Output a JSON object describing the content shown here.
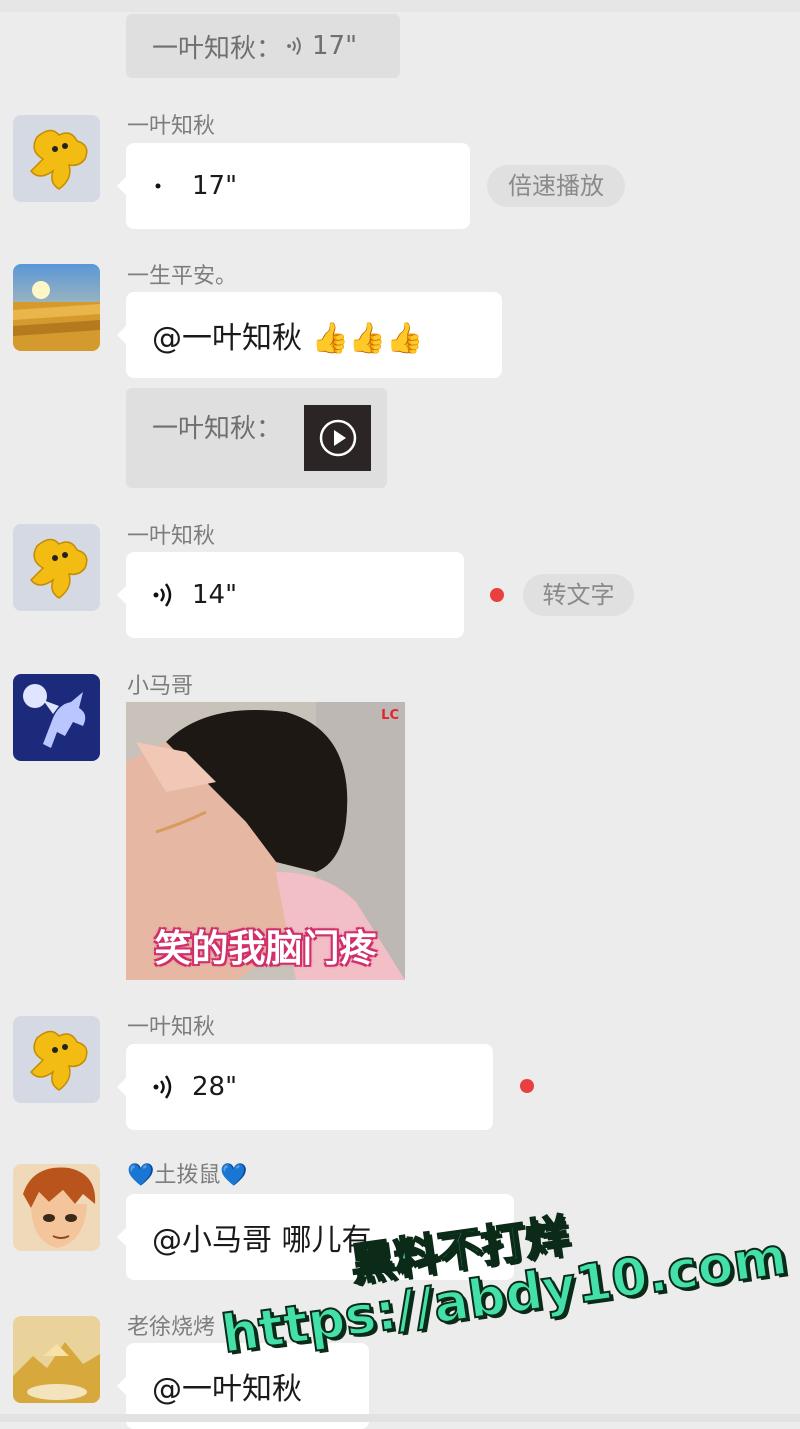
{
  "messages": {
    "quote_top": {
      "text": "一叶知秋：",
      "duration": "17\""
    },
    "msg1": {
      "sender": "一叶知秋",
      "duration": "17\"",
      "action": "倍速播放"
    },
    "msg2": {
      "sender": "一生平安。",
      "text": "@一叶知秋 👍👍👍",
      "quote_text": "一叶知秋："
    },
    "msg3": {
      "sender": "一叶知秋",
      "duration": "14\"",
      "action": "转文字"
    },
    "msg4": {
      "sender": "小马哥",
      "sticker_caption": "笑的我脑门疼",
      "sticker_tag": "LC"
    },
    "msg5": {
      "sender": "一叶知秋",
      "duration": "28\""
    },
    "msg6": {
      "sender_prefix": "💙",
      "sender": "土拨鼠",
      "sender_suffix": "💙",
      "text": "@小马哥 哪儿有"
    },
    "msg7": {
      "sender": "老徐烧烤",
      "text": "@一叶知秋"
    }
  },
  "watermark": {
    "line1": "黑料不打烊",
    "line2": "https://abdy10.com"
  },
  "colors": {
    "background": "#ececec",
    "bubble": "#ffffff",
    "unread": "#e84040",
    "watermark": "#43e1a9"
  }
}
